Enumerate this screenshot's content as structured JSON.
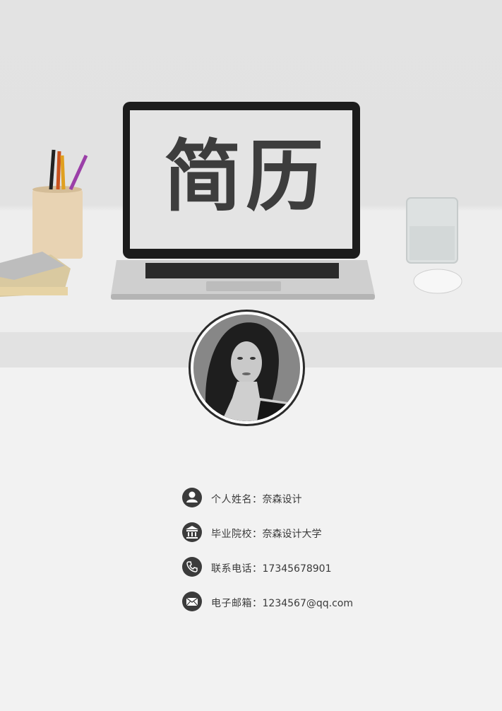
{
  "hero": {
    "screen_title": "简历",
    "icon": "laptop-photo"
  },
  "profile": {
    "photo_icon": "portrait-photo"
  },
  "info": [
    {
      "icon": "person-icon",
      "label": "个人姓名：",
      "value": "奈森设计"
    },
    {
      "icon": "school-icon",
      "label": "毕业院校：",
      "value": "奈森设计大学"
    },
    {
      "icon": "phone-icon",
      "label": "联系电话：",
      "value": "17345678901"
    },
    {
      "icon": "mail-icon",
      "label": "电子邮箱：",
      "value": "1234567@qq.com"
    }
  ],
  "colors": {
    "background": "#f2f2f2",
    "icon_bg": "#3b3b3b",
    "text": "#3a3a3a"
  }
}
